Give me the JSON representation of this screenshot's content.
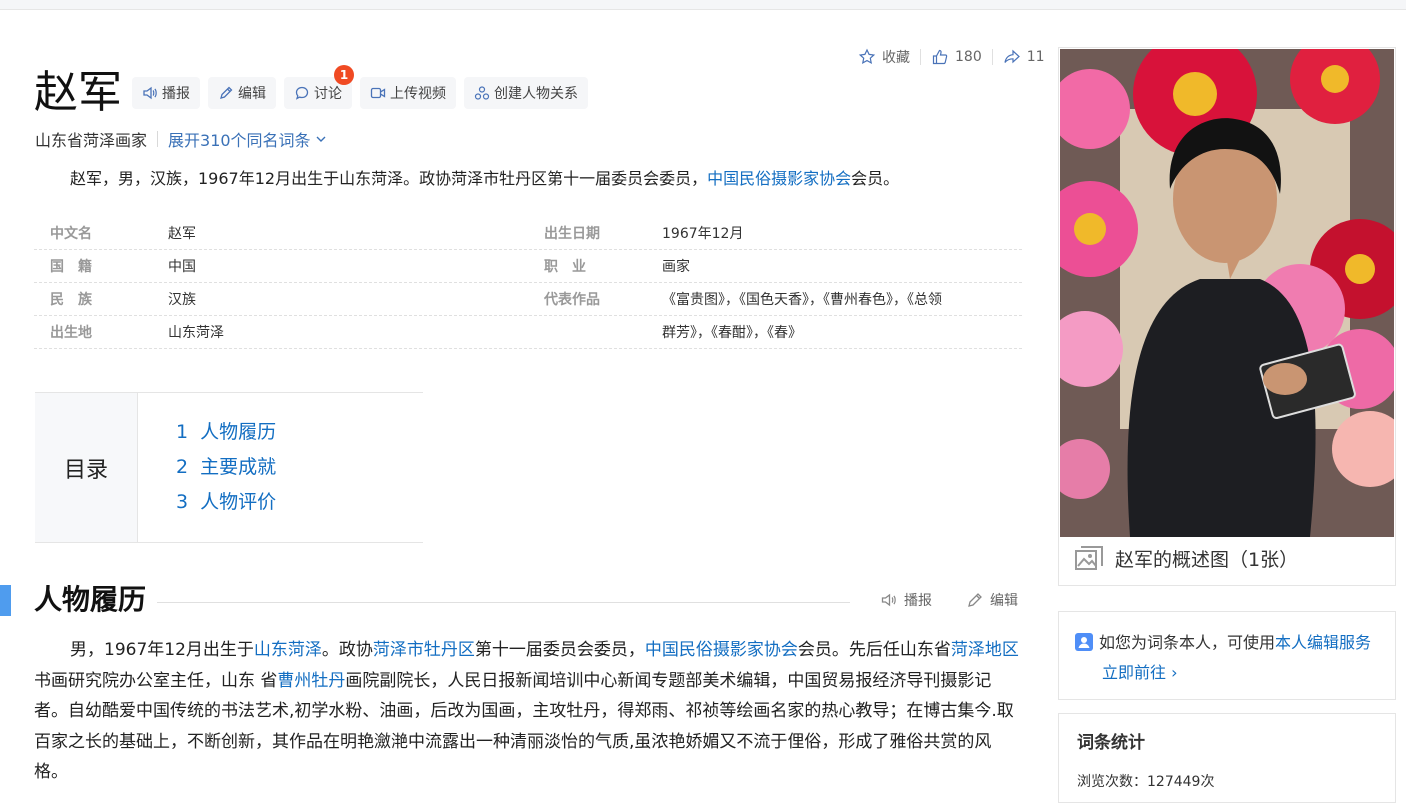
{
  "entry": {
    "title": "赵军",
    "toolbar": [
      {
        "label": "播报",
        "icon": "speaker-icon"
      },
      {
        "label": "编辑",
        "icon": "pencil-icon"
      },
      {
        "label": "讨论",
        "icon": "chat-icon",
        "badge": "1"
      },
      {
        "label": "上传视频",
        "icon": "video-icon"
      },
      {
        "label": "创建人物关系",
        "icon": "relation-icon"
      }
    ],
    "subtitle": "山东省菏泽画家",
    "expand_label": "展开310个同名词条",
    "actions": {
      "favorite_label": "收藏",
      "like_count": "180",
      "share_count": "11"
    }
  },
  "summary": {
    "text_before": "赵军，男，汉族，1967年12月出生于山东菏泽。政协菏泽市牡丹区第十一届委员会委员，",
    "link": "中国民俗摄影家协会",
    "text_after": "会员。"
  },
  "infobox": {
    "left": [
      {
        "key": "中文名",
        "value": "赵军",
        "link": false
      },
      {
        "key": "国　籍",
        "value": "中国",
        "link": true
      },
      {
        "key": "民　族",
        "value": "汉族",
        "link": false
      },
      {
        "key": "出生地",
        "value": "山东菏泽",
        "link": false
      }
    ],
    "right": [
      {
        "key": "出生日期",
        "value": "1967年12月"
      },
      {
        "key": "职　业",
        "value": "画家"
      },
      {
        "key": "代表作品",
        "value": "《富贵图》，《国色天香》，《曹州春色》，《总领"
      },
      {
        "key": "",
        "value": "群芳》，《春酣》，《春》"
      }
    ]
  },
  "toc": {
    "label": "目录",
    "items": [
      {
        "num": "1",
        "label": "人物履历"
      },
      {
        "num": "2",
        "label": "主要成就"
      },
      {
        "num": "3",
        "label": "人物评价"
      }
    ]
  },
  "section": {
    "title": "人物履历",
    "broadcast_label": "播报",
    "edit_label": "编辑",
    "paragraph": {
      "p1": "男，1967年12月出生于",
      "l1": "山东菏泽",
      "p2": "。政协",
      "l2": "菏泽市牡丹区",
      "p3": "第十一届委员会委员，",
      "l3": "中国民俗摄影家协会",
      "p4": "会员。先后任山东省",
      "l4": "菏泽地区",
      "p5": "书画研究院办公室主任，山东 省",
      "l5": "曹州牡丹",
      "p6": "画院副院长，人民日报新闻培训中心新闻专题部美术编辑，中国贸易报经济导刊摄影记者。自幼酷爱中国传统的书法艺术,初学水粉、油画，后改为国画，主攻牡丹，得郑雨、祁祯等绘画名家的热心教导；在博古集今.取百家之长的基础上，不断创新，其作品在明艳瀲滟中流露出一种清丽淡怡的气质,虽浓艳娇媚又不流于俚俗，形成了雅俗共赏的风格。"
    }
  },
  "sidebar": {
    "photo_caption": "赵军的概述图（1张）",
    "self_edit": {
      "text": "如您为词条本人，可使用",
      "link": "本人编辑服务",
      "go_label": "立即前往",
      "go_chevron": "›"
    },
    "stats": {
      "title": "词条统计",
      "views_label": "浏览次数：",
      "views_value": "127449次"
    }
  },
  "colors": {
    "link": "#136ec2",
    "accent_bar": "#4f9cee",
    "badge": "#f04a23",
    "icon": "#4a73b8"
  }
}
